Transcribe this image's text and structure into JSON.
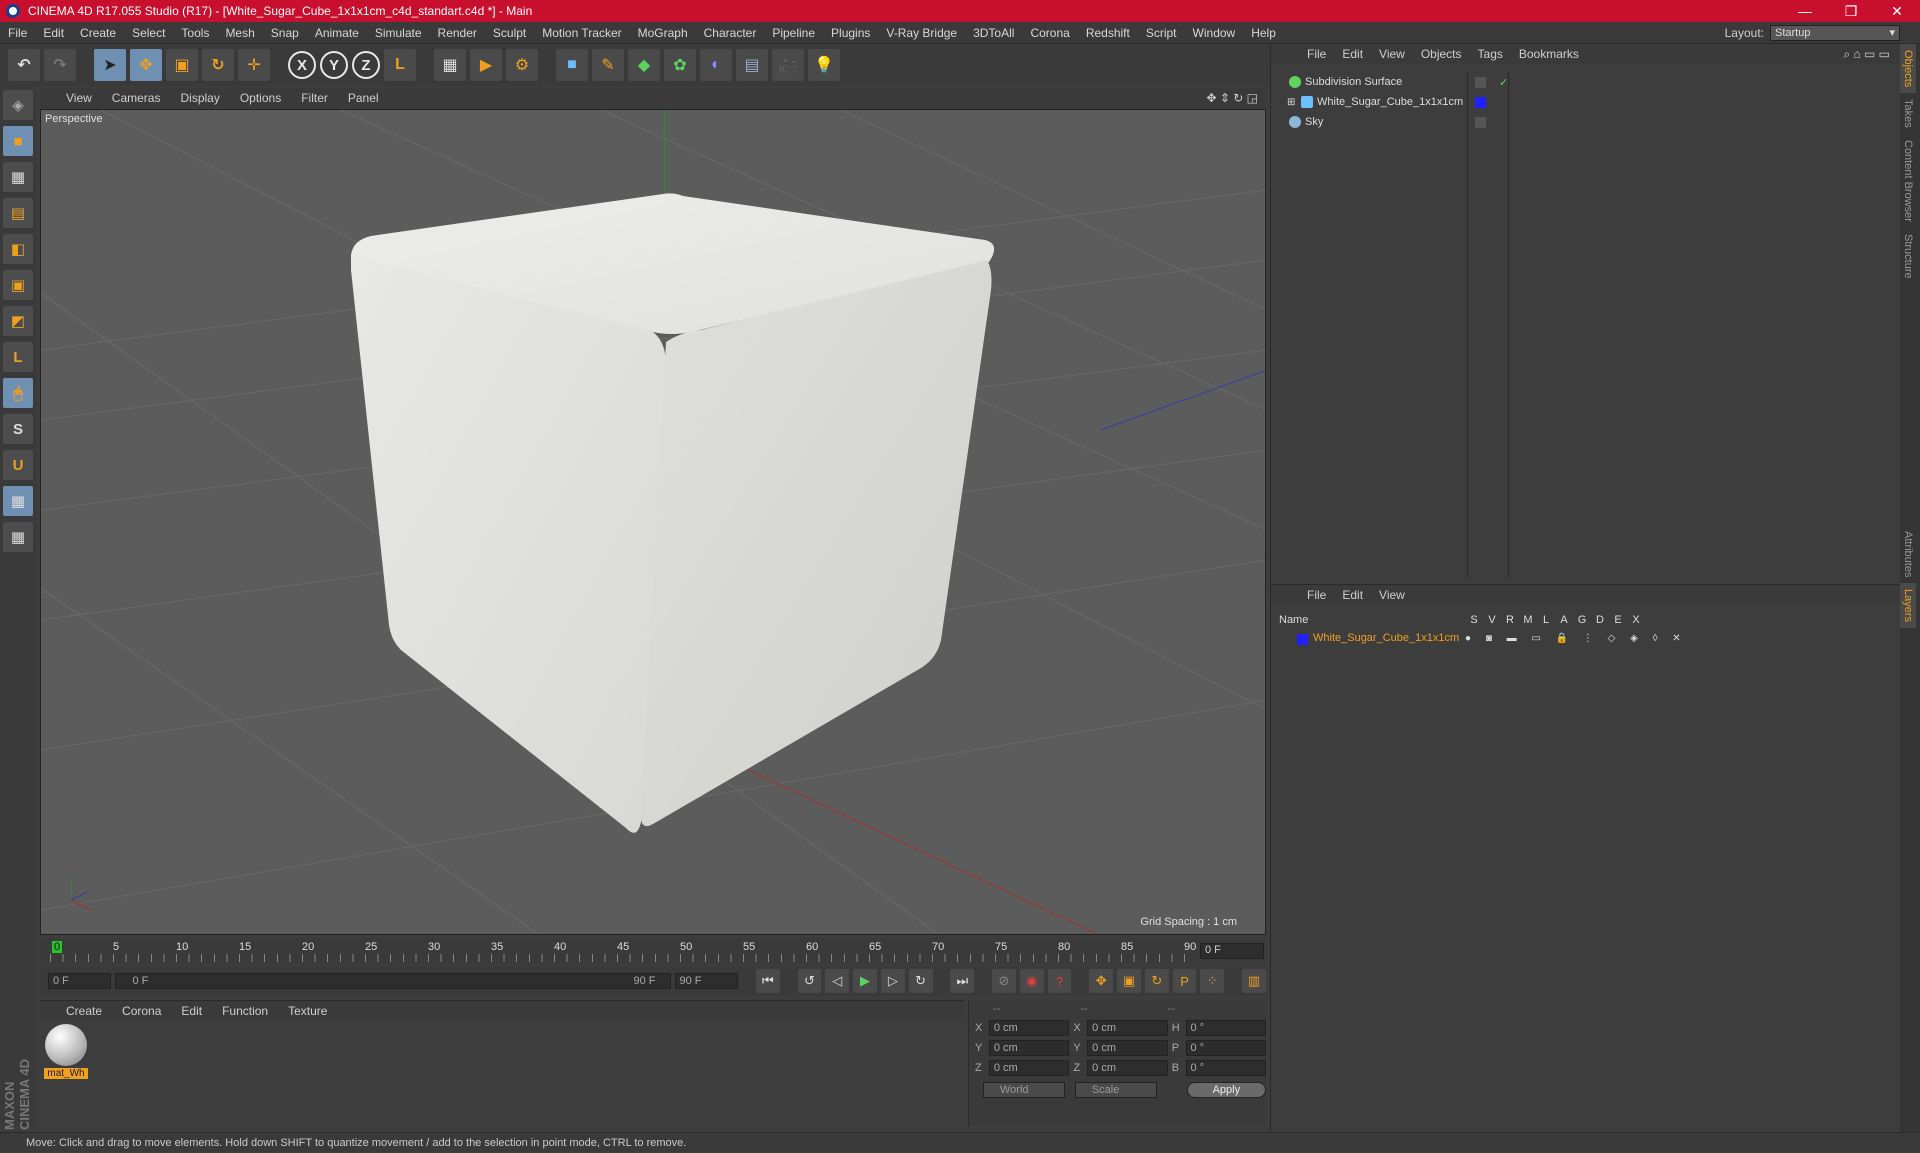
{
  "window": {
    "title": "CINEMA 4D R17.055 Studio (R17) - [White_Sugar_Cube_1x1x1cm_c4d_standart.c4d *] - Main",
    "minimize": "—",
    "maximize": "❐",
    "close": "✕"
  },
  "menubar": {
    "items": [
      "File",
      "Edit",
      "Create",
      "Select",
      "Tools",
      "Mesh",
      "Snap",
      "Animate",
      "Simulate",
      "Render",
      "Sculpt",
      "Motion Tracker",
      "MoGraph",
      "Character",
      "Pipeline",
      "Plugins",
      "V-Ray Bridge",
      "3DToAll",
      "Corona",
      "Redshift",
      "Script",
      "Window",
      "Help"
    ],
    "layout_label": "Layout:",
    "layout_value": "Startup"
  },
  "toolbar": {
    "undo": "↶",
    "redo": "↷",
    "select": "➤",
    "move": "✥",
    "scale": "▣",
    "rotate": "↻",
    "recent": "✛",
    "axis_x": "X",
    "axis_y": "Y",
    "axis_z": "Z",
    "coord": "L",
    "render_view": "▦",
    "render_pv": "▶",
    "render_settings": "⚙",
    "cube": "■",
    "pen": "✎",
    "subdiv": "◆",
    "cloner": "✿",
    "deformer": "◐",
    "floor": "▤",
    "camera": "🎥",
    "light": "💡"
  },
  "left_tools": [
    "◈",
    "■",
    "▦",
    "▤",
    "◧",
    "▣",
    "◩",
    "L",
    "🖱",
    "S",
    "U",
    "▦",
    "▦"
  ],
  "viewport": {
    "menu": [
      "View",
      "Cameras",
      "Display",
      "Options",
      "Filter",
      "Panel"
    ],
    "camera_label": "Perspective",
    "grid_spacing": "Grid Spacing : 1 cm"
  },
  "timeline": {
    "ticks": [
      "0",
      "5",
      "10",
      "15",
      "20",
      "25",
      "30",
      "35",
      "40",
      "45",
      "50",
      "55",
      "60",
      "65",
      "70",
      "75",
      "80",
      "85",
      "90"
    ],
    "current_frame": "0 F"
  },
  "playbar": {
    "start": "0 F",
    "range_start": "0 F",
    "range_end": "90 F",
    "end": "90 F"
  },
  "material_manager": {
    "menu": [
      "Create",
      "Corona",
      "Edit",
      "Function",
      "Texture"
    ],
    "materials": [
      {
        "name": "mat_Wh"
      }
    ]
  },
  "coordinates": {
    "head": [
      "--",
      "--",
      "--"
    ],
    "rows": [
      {
        "a": "X",
        "av": "0 cm",
        "b": "X",
        "bv": "0 cm",
        "c": "H",
        "cv": "0 °"
      },
      {
        "a": "Y",
        "av": "0 cm",
        "b": "Y",
        "bv": "0 cm",
        "c": "P",
        "cv": "0 °"
      },
      {
        "a": "Z",
        "av": "0 cm",
        "b": "Z",
        "bv": "0 cm",
        "c": "B",
        "cv": "0 °"
      }
    ],
    "mode": "World",
    "scale": "Scale",
    "apply": "Apply"
  },
  "object_manager": {
    "menu": [
      "File",
      "Edit",
      "View",
      "Objects",
      "Tags",
      "Bookmarks"
    ],
    "objects": [
      {
        "name": "Subdivision Surface",
        "check": "✓"
      },
      {
        "name": "White_Sugar_Cube_1x1x1cm"
      },
      {
        "name": "Sky"
      }
    ]
  },
  "layer_manager": {
    "menu": [
      "File",
      "Edit",
      "View"
    ],
    "columns": [
      "Name",
      "S",
      "V",
      "R",
      "M",
      "L",
      "A",
      "G",
      "D",
      "E",
      "X"
    ],
    "layers": [
      {
        "name": "White_Sugar_Cube_1x1x1cm"
      }
    ]
  },
  "right_tabs": [
    "Objects",
    "Takes",
    "Content Browser",
    "Structure",
    "Attributes",
    "Layers"
  ],
  "status": "Move: Click and drag to move elements. Hold down SHIFT to quantize movement / add to the selection in point mode, CTRL to remove.",
  "colors": {
    "accent": "#f0a020",
    "title_bar": "#c8102e",
    "layer_color": "#2020ff"
  }
}
